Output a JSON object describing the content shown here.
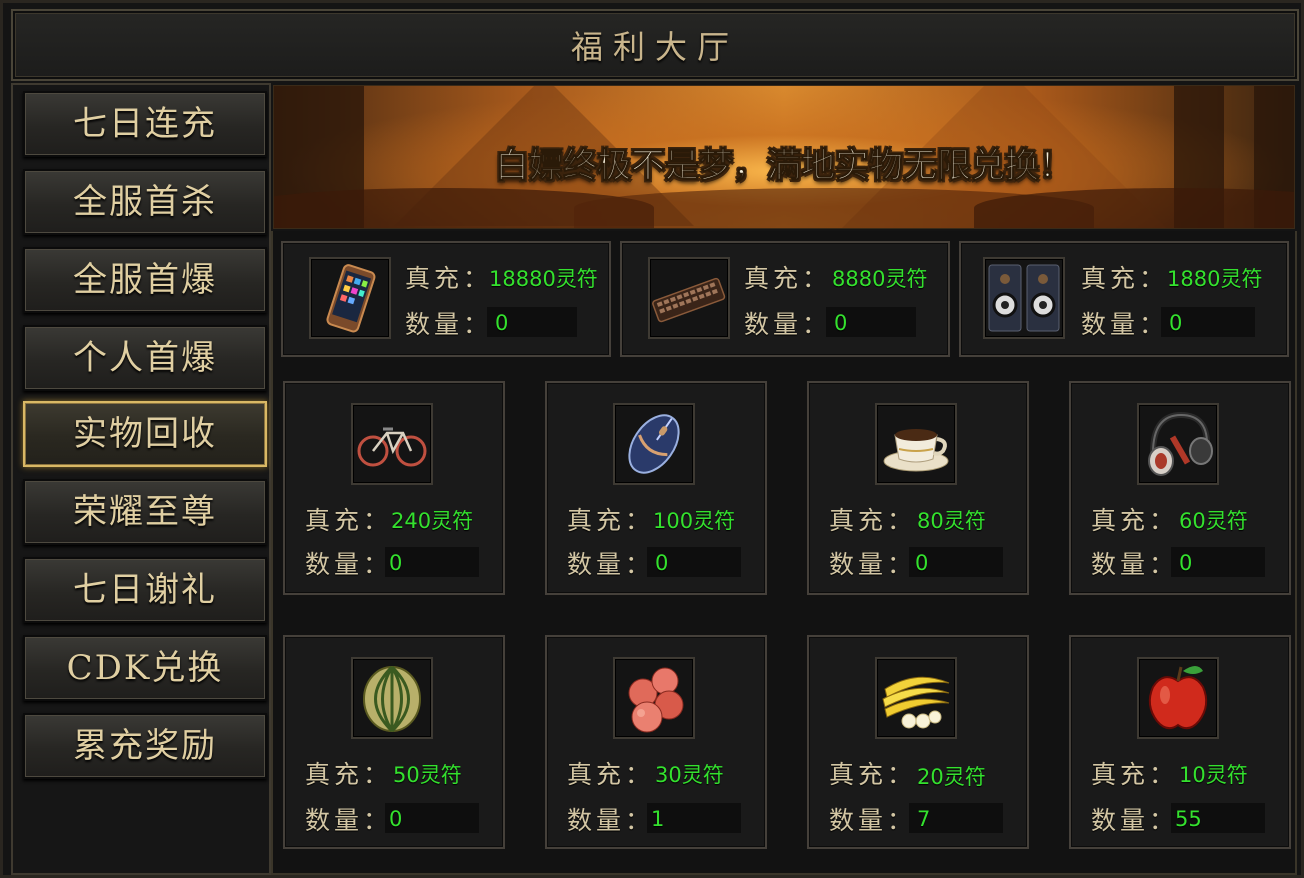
{
  "title": "福利大厅",
  "banner_text": "白嫖终极不是梦，满地实物无限兑换！",
  "sidebar": {
    "items": [
      {
        "label": "七日连充"
      },
      {
        "label": "全服首杀"
      },
      {
        "label": "全服首爆"
      },
      {
        "label": "个人首爆"
      },
      {
        "label": "实物回收",
        "active": true
      },
      {
        "label": "荣耀至尊"
      },
      {
        "label": "七日谢礼"
      },
      {
        "label": "CDK兑换"
      },
      {
        "label": "累充奖励"
      }
    ]
  },
  "labels": {
    "recharge": "真充：",
    "quantity": "数量："
  },
  "top_items": [
    {
      "icon": "phone-icon",
      "price": "18880灵符",
      "qty": "0"
    },
    {
      "icon": "keyboard-icon",
      "price": "8880灵符",
      "qty": "0"
    },
    {
      "icon": "speaker-icon",
      "price": "1880灵符",
      "qty": "0"
    }
  ],
  "row2_items": [
    {
      "icon": "bicycle-icon",
      "price": "240灵符",
      "qty": "0"
    },
    {
      "icon": "mouse-icon",
      "price": "100灵符",
      "qty": "0"
    },
    {
      "icon": "coffee-cup-icon",
      "price": "80灵符",
      "qty": "0"
    },
    {
      "icon": "headphones-icon",
      "price": "60灵符",
      "qty": "0"
    }
  ],
  "row3_items": [
    {
      "icon": "melon-icon",
      "price": "50灵符",
      "qty": "0"
    },
    {
      "icon": "peaches-icon",
      "price": "30灵符",
      "qty": "1"
    },
    {
      "icon": "banana-icon",
      "price": "20灵符",
      "qty": "7"
    },
    {
      "icon": "apple-icon",
      "price": "10灵符",
      "qty": "55"
    }
  ],
  "colors": {
    "value_green": "#34e12e",
    "gold_border": "#d9b865",
    "label": "#d3c6a4"
  }
}
